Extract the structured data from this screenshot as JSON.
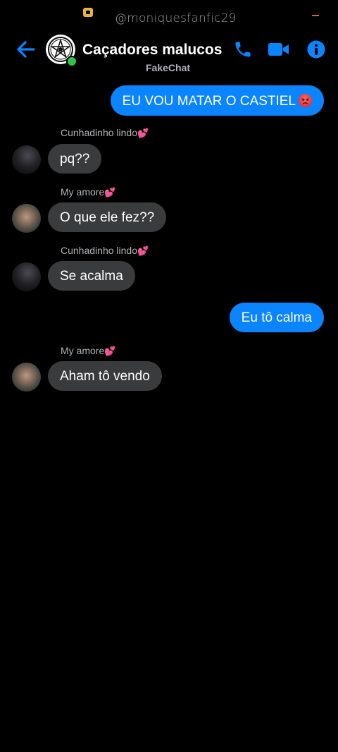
{
  "status_bar": {
    "watermark": "@moniquesfanfic29"
  },
  "header": {
    "title": "Caçadores malucos",
    "subtitle": "FakeChat",
    "avatar_icon": "pentagram-seal-icon",
    "online": true
  },
  "colors": {
    "outgoing_bubble": "#0a84ff",
    "incoming_bubble": "#3a3b3c",
    "accent": "#0a84ff",
    "online_dot": "#31c24d"
  },
  "messages": [
    {
      "direction": "out",
      "text": "EU VOU MATAR O CASTIEL",
      "emoji": "angry-face-emoji"
    },
    {
      "direction": "in",
      "sender": "Cunhadinho lindo",
      "sender_emoji": "💕",
      "text": "pq??"
    },
    {
      "direction": "in",
      "sender": "My amore",
      "sender_emoji": "💕",
      "text": "O que ele fez??"
    },
    {
      "direction": "in",
      "sender": "Cunhadinho lindo",
      "sender_emoji": "💕",
      "text": "Se acalma"
    },
    {
      "direction": "out",
      "text": "Eu tô calma"
    },
    {
      "direction": "in",
      "sender": "My amore",
      "sender_emoji": "💕",
      "text": "Aham tô vendo"
    }
  ]
}
